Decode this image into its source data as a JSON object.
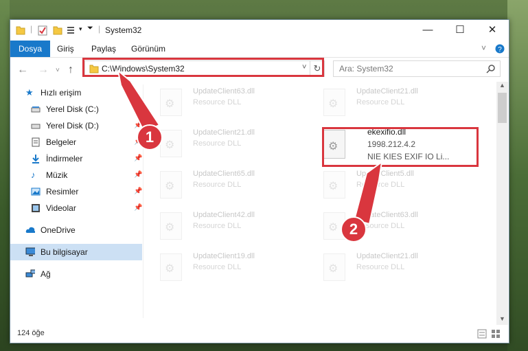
{
  "window": {
    "title": "System32",
    "minimize": "—",
    "maximize": "☐",
    "close": "✕"
  },
  "ribbon": {
    "tabs": [
      "Dosya",
      "Giriş",
      "Paylaş",
      "Görünüm"
    ]
  },
  "address": {
    "path": "C:\\Windows\\System32",
    "search_placeholder": "Ara: System32"
  },
  "nav": {
    "items": [
      {
        "label": "Hızlı erişim",
        "icon": "star-icon"
      },
      {
        "label": "Yerel Disk (C:)",
        "icon": "drive-icon"
      },
      {
        "label": "Yerel Disk (D:)",
        "icon": "drive-icon"
      },
      {
        "label": "Belgeler",
        "icon": "documents-icon"
      },
      {
        "label": "İndirmeler",
        "icon": "download-icon"
      },
      {
        "label": "Müzik",
        "icon": "music-icon"
      },
      {
        "label": "Resimler",
        "icon": "pictures-icon"
      },
      {
        "label": "Videolar",
        "icon": "video-icon"
      },
      {
        "label": "OneDrive",
        "icon": "cloud-icon"
      },
      {
        "label": "Bu bilgisayar",
        "icon": "computer-icon"
      },
      {
        "label": "Ağ",
        "icon": "network-icon"
      }
    ]
  },
  "files": {
    "f0": {
      "name": "UpdateClient63.dll",
      "desc": "Resource DLL"
    },
    "f1": {
      "name": "UpdateClient21.dll",
      "desc": "Resource DLL"
    },
    "f2": {
      "name": "UpdateClient21.dll",
      "desc": "Resource DLL"
    },
    "f3": {
      "name": "ekexifio.dll",
      "desc": "1998.212.4.2",
      "desc2": "NIE KIES EXIF IO Li..."
    },
    "f4": {
      "name": "UpdateClient65.dll",
      "desc": "Resource DLL"
    },
    "f5": {
      "name": "UpdateClient5.dll",
      "desc": "Resource DLL"
    },
    "f6": {
      "name": "UpdateClient42.dll",
      "desc": "Resource DLL"
    },
    "f7": {
      "name": "UpdateClient63.dll",
      "desc": "Resource DLL"
    },
    "f8": {
      "name": "UpdateClient19.dll",
      "desc": "Resource DLL"
    },
    "f9": {
      "name": "UpdateClient21.dll",
      "desc": "Resource DLL"
    }
  },
  "status": {
    "count": "124 öğe"
  },
  "annotations": {
    "one": "1",
    "two": "2",
    "color": "#d9363e"
  }
}
